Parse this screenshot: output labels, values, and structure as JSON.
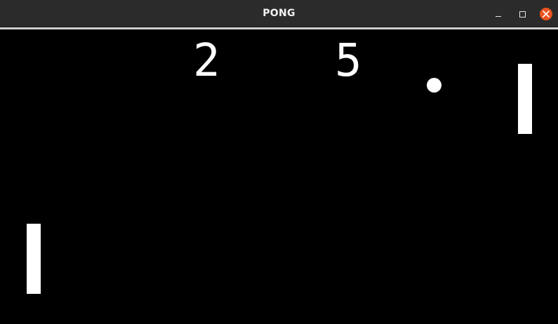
{
  "window": {
    "title": "PONG",
    "icons": {
      "minimize": "minimize-icon",
      "maximize": "maximize-icon",
      "close": "close-icon"
    },
    "accent_color": "#e95420"
  },
  "game": {
    "scores": {
      "left": "2",
      "right": "5"
    },
    "background_color": "#000000",
    "foreground_color": "#ffffff"
  }
}
